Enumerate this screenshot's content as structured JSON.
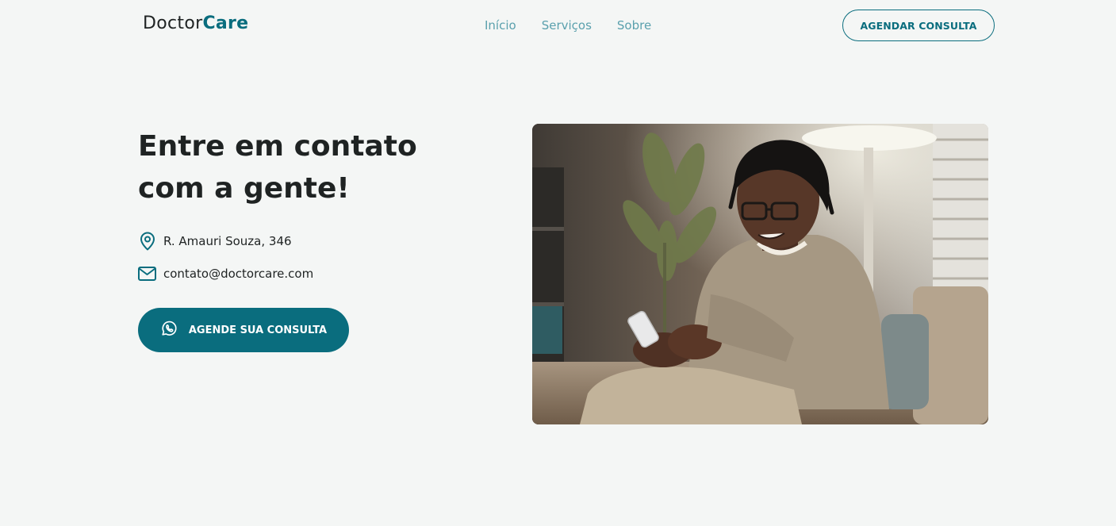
{
  "header": {
    "logo_part1": "Doctor",
    "logo_part2": "Care",
    "nav": [
      "Início",
      "Serviços",
      "Sobre"
    ],
    "cta_label": "AGENDAR CONSULTA"
  },
  "contact": {
    "headline_line1": "Entre em contato",
    "headline_line2": "com a gente!",
    "address": "R. Amauri Souza, 346",
    "email": "contato@doctorcare.com",
    "button_label": "AGENDE SUA CONSULTA"
  },
  "icons": {
    "address": "location-pin-icon",
    "email": "mail-icon",
    "button": "whatsapp-icon"
  },
  "colors": {
    "primary": "#0a6d7e",
    "nav_link": "#5aa0ad",
    "text": "#1f2323",
    "background": "#f4f6f5"
  }
}
